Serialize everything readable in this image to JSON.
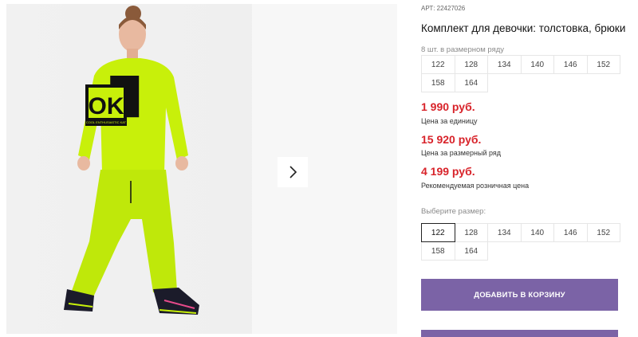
{
  "product": {
    "art_label": "АРТ:",
    "art_number": "22427026",
    "title": "Комплект для девочки: толстовка, брюки",
    "graphic_text": "OK",
    "graphic_small_text": "COOL ENTHUSIASTIC KAT"
  },
  "pack": {
    "label": "8 шт. в размерном ряду",
    "sizes": [
      "122",
      "128",
      "134",
      "140",
      "146",
      "152",
      "158",
      "164"
    ]
  },
  "prices": [
    {
      "value": "1 990 руб.",
      "caption": "Цена за единицу"
    },
    {
      "value": "15 920 руб.",
      "caption": "Цена за размерный ряд"
    },
    {
      "value": "4 199 руб.",
      "caption": "Рекомендуемая розничная цена"
    }
  ],
  "size_select": {
    "label": "Выберите размер:",
    "sizes": [
      "122",
      "128",
      "134",
      "140",
      "146",
      "152",
      "158",
      "164"
    ],
    "selected": "122"
  },
  "actions": {
    "add_to_cart": "ДОБАВИТЬ В КОРЗИНУ"
  },
  "colors": {
    "price": "#d8232a",
    "button": "#7b63a6",
    "outfit": "#c8f00a"
  },
  "icons": {
    "next": "chevron-right-icon"
  }
}
